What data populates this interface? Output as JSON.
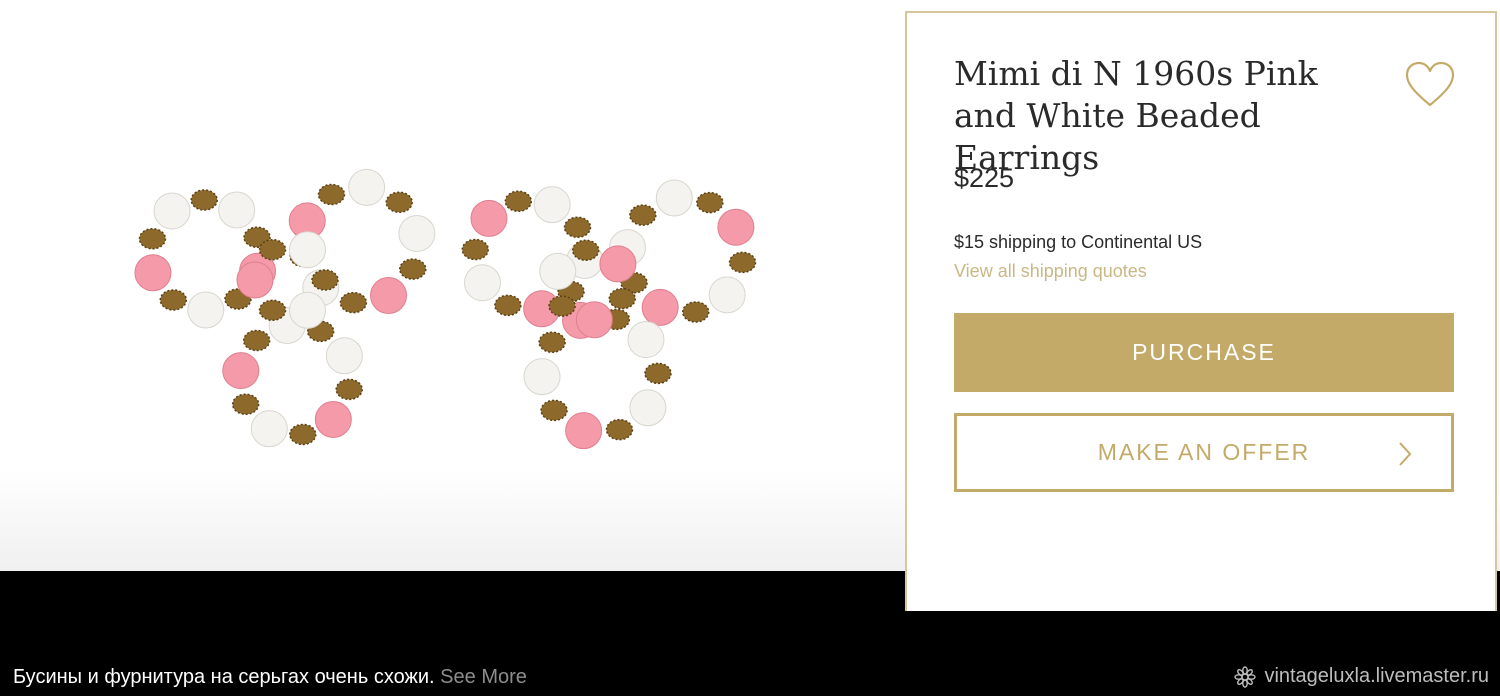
{
  "product": {
    "title": "Mimi di N 1960s Pink and White Beaded Earrings",
    "price": "$225",
    "shipping_text": "$15 shipping to Continental US",
    "shipping_link": "View all shipping quotes",
    "purchase_label": "PURCHASE",
    "offer_label": "MAKE AN OFFER",
    "favorite_icon": "heart-icon"
  },
  "image": {
    "subject": "pink and white beaded earrings"
  },
  "caption": {
    "text": "Бусины и фурнитура на серьгах очень схожи.",
    "see_more": "See More"
  },
  "watermark": {
    "text": "vintageluxla.livemaster.ru",
    "icon": "flower-icon"
  },
  "colors": {
    "accent_gold": "#c4aa68",
    "panel_border": "#d7c69c",
    "link_gold": "#c9b784",
    "bead_pink": "#f59aa8",
    "bead_white": "#f4f3ef",
    "bead_gold": "#8d6a2c"
  }
}
